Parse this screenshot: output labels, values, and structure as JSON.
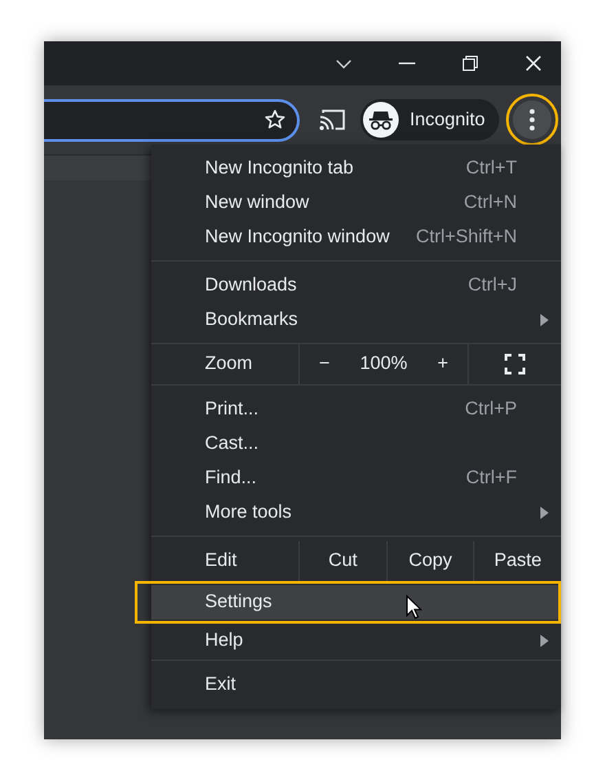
{
  "toolbar": {
    "incognito_label": "Incognito",
    "menu_button": {
      "highlighted": true
    }
  },
  "menu": {
    "sections": [
      {
        "items": [
          {
            "kind": "item",
            "label": "New Incognito tab",
            "shortcut": "Ctrl+T",
            "submenu": false,
            "selected": false
          },
          {
            "kind": "item",
            "label": "New window",
            "shortcut": "Ctrl+N",
            "submenu": false,
            "selected": false
          },
          {
            "kind": "item",
            "label": "New Incognito window",
            "shortcut": "Ctrl+Shift+N",
            "submenu": false,
            "selected": false
          }
        ]
      },
      {
        "items": [
          {
            "kind": "item",
            "label": "Downloads",
            "shortcut": "Ctrl+J",
            "submenu": false,
            "selected": false
          },
          {
            "kind": "item",
            "label": "Bookmarks",
            "submenu": true,
            "selected": false
          }
        ]
      },
      {
        "items": [
          {
            "kind": "zoom",
            "label": "Zoom",
            "minus": "−",
            "value": "100%",
            "plus": "+"
          }
        ]
      },
      {
        "items": [
          {
            "kind": "item",
            "label": "Print...",
            "shortcut": "Ctrl+P",
            "submenu": false,
            "selected": false
          },
          {
            "kind": "item",
            "label": "Cast...",
            "submenu": false,
            "selected": false
          },
          {
            "kind": "item",
            "label": "Find...",
            "shortcut": "Ctrl+F",
            "submenu": false,
            "selected": false
          },
          {
            "kind": "item",
            "label": "More tools",
            "submenu": true,
            "selected": false
          }
        ]
      },
      {
        "items": [
          {
            "kind": "edit",
            "label": "Edit",
            "buttons": [
              "Cut",
              "Copy",
              "Paste"
            ]
          },
          {
            "kind": "item",
            "label": "Settings",
            "submenu": false,
            "selected": true
          },
          {
            "kind": "item",
            "label": "Help",
            "submenu": true,
            "selected": false
          }
        ]
      },
      {
        "items": [
          {
            "kind": "item",
            "label": "Exit",
            "submenu": false,
            "selected": false
          }
        ]
      }
    ]
  }
}
